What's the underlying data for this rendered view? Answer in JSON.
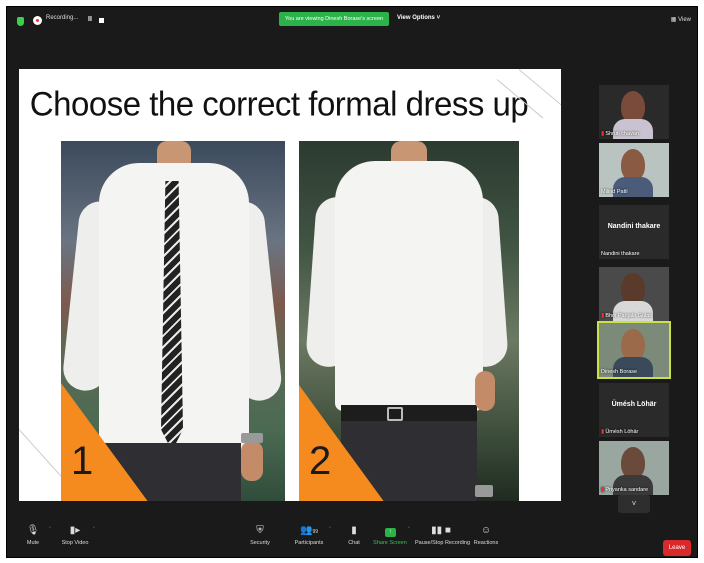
{
  "topbar": {
    "recording_label": "Recording...",
    "pause_label": "II",
    "viewing_notice": "You are viewing Dinesh Borase's screen",
    "view_options_label": "View Options ˅",
    "view_label": "▦ View"
  },
  "slide": {
    "title": "Choose the correct formal dress up",
    "option1_number": "1",
    "option2_number": "2"
  },
  "participants": [
    {
      "name": "Shruti chavan",
      "muted": true
    },
    {
      "name": "Milind Patil",
      "muted": false
    },
    {
      "name": "Nandini thakare",
      "center_name": "Nandini thakare",
      "muted": false
    },
    {
      "name": "Bhoi Panjala Gulab",
      "muted": true
    },
    {
      "name": "Dinesh Borase",
      "muted": false,
      "active": true
    },
    {
      "name": "Ümésh Löhär",
      "center_name": "Ümésh Löhär",
      "muted": true
    },
    {
      "name": "Priyanka sandare",
      "muted": true
    }
  ],
  "gallery_more": "˅",
  "toolbar": {
    "mute": "Mute",
    "stop_video": "Stop Video",
    "security": "Security",
    "participants": "Participants",
    "participants_count": "99",
    "chat": "Chat",
    "share_screen": "Share Screen",
    "pause_stop_recording": "Pause/Stop Recording",
    "reactions": "Reactions",
    "leave": "Leave"
  },
  "colors": {
    "accent_green": "#2bb34a",
    "leave_red": "#d9292b",
    "slide_orange": "#f58a1f",
    "active_speaker": "#c9e24a"
  }
}
